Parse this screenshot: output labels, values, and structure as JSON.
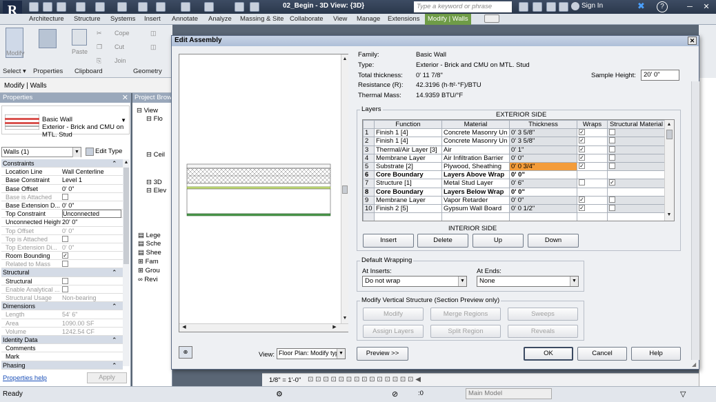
{
  "app": {
    "logo_letter": "R",
    "doc_title": "02_Begin - 3D View: {3D}",
    "search_placeholder": "Type a keyword or phrase",
    "sign_in": "Sign In",
    "help": "?",
    "close_x": "✕"
  },
  "ribbon_tabs": [
    "Architecture",
    "Structure",
    "Systems",
    "Insert",
    "Annotate",
    "Analyze",
    "Massing & Site",
    "Collaborate",
    "View",
    "Manage",
    "Extensions",
    "Modify | Walls"
  ],
  "ribbon": {
    "modify": "Modify",
    "paste": "Paste",
    "cope": "Cope",
    "cut": "Cut",
    "join": "Join",
    "groups": {
      "select": "Select",
      "properties": "Properties",
      "clipboard": "Clipboard",
      "geometry": "Geometry"
    }
  },
  "context_label": "Modify | Walls",
  "properties": {
    "header": "Properties",
    "type_family": "Basic Wall",
    "type_name": "Exterior - Brick and CMU on MTL. Stud",
    "instance_selector": "Walls (1)",
    "edit_type": "Edit Type",
    "rows": [
      {
        "k": "Constraints",
        "v": "",
        "group": true
      },
      {
        "k": "Location Line",
        "v": "Wall Centerline"
      },
      {
        "k": "Base Constraint",
        "v": "Level 1"
      },
      {
        "k": "Base Offset",
        "v": "0' 0\""
      },
      {
        "k": "Base is Attached",
        "v": "",
        "check": false,
        "dim": true
      },
      {
        "k": "Base Extension D...",
        "v": "0' 0\""
      },
      {
        "k": "Top Constraint",
        "v": "Unconnected"
      },
      {
        "k": "Unconnected Height",
        "v": "20' 0\""
      },
      {
        "k": "Top Offset",
        "v": "0' 0\"",
        "dim": true
      },
      {
        "k": "Top is Attached",
        "v": "",
        "check": false,
        "dim": true
      },
      {
        "k": "Top Extension Di...",
        "v": "0' 0\"",
        "dim": true
      },
      {
        "k": "Room Bounding",
        "v": "",
        "check": true
      },
      {
        "k": "Related to Mass",
        "v": "",
        "check": false,
        "dim": true
      },
      {
        "k": "Structural",
        "v": "",
        "group": true
      },
      {
        "k": "Structural",
        "v": "",
        "check": false
      },
      {
        "k": "Enable Analytical ...",
        "v": "",
        "check": false,
        "dim": true
      },
      {
        "k": "Structural Usage",
        "v": "Non-bearing",
        "dim": true
      },
      {
        "k": "Dimensions",
        "v": "",
        "group": true
      },
      {
        "k": "Length",
        "v": "54' 6\"",
        "dim": true
      },
      {
        "k": "Area",
        "v": "1090.00 SF",
        "dim": true
      },
      {
        "k": "Volume",
        "v": "1242.54 CF",
        "dim": true
      },
      {
        "k": "Identity Data",
        "v": "",
        "group": true
      },
      {
        "k": "Comments",
        "v": ""
      },
      {
        "k": "Mark",
        "v": ""
      },
      {
        "k": "Phasing",
        "v": "",
        "group": true
      }
    ],
    "help_link": "Properties help",
    "apply": "Apply"
  },
  "project_browser": {
    "header": "Project Brow",
    "items": [
      "View",
      "Flo",
      "Ceil",
      "3D",
      "Elev",
      "Lege",
      "Sche",
      "Shee",
      "Fam",
      "Grou",
      "Revi"
    ]
  },
  "dialog": {
    "title": "Edit Assembly",
    "info": [
      {
        "label": "Family:",
        "value": "Basic Wall"
      },
      {
        "label": "Type:",
        "value": "Exterior - Brick and CMU on MTL. Stud"
      },
      {
        "label": "Total thickness:",
        "value": "0'  11 7/8\""
      },
      {
        "label": "Resistance (R):",
        "value": "42.3196 (h·ft²·°F)/BTU"
      },
      {
        "label": "Thermal Mass:",
        "value": "14.9359 BTU/°F"
      }
    ],
    "sample_height_label": "Sample Height:",
    "sample_height_value": "20'  0\"",
    "layers_title": "Layers",
    "exterior_side": "EXTERIOR SIDE",
    "interior_side": "INTERIOR SIDE",
    "columns": [
      "",
      "Function",
      "Material",
      "Thickness",
      "Wraps",
      "Structural Material"
    ],
    "layers": [
      {
        "n": "1",
        "function": "Finish 1 [4]",
        "material": "Concrete Masonry Un",
        "thickness": "0'  3 5/8\"",
        "wraps": true,
        "struct": false
      },
      {
        "n": "2",
        "function": "Finish 1 [4]",
        "material": "Concrete Masonry Un",
        "thickness": "0'  3 5/8\"",
        "wraps": true,
        "struct": false
      },
      {
        "n": "3",
        "function": "Thermal/Air Layer [3]",
        "material": "Air",
        "thickness": "0'  1\"",
        "wraps": true,
        "struct": false
      },
      {
        "n": "4",
        "function": "Membrane Layer",
        "material": "Air Infiltration Barrier",
        "thickness": "0'  0\"",
        "wraps": true,
        "struct": false
      },
      {
        "n": "5",
        "function": "Substrate [2]",
        "material": "Plywood, Sheathing",
        "thickness": "0'  0 3/4\"",
        "wraps": true,
        "struct": false,
        "highlight": true
      },
      {
        "n": "6",
        "function": "Core Boundary",
        "material": "Layers Above Wrap",
        "thickness": "0'  0\"",
        "core": true
      },
      {
        "n": "7",
        "function": "Structure [1]",
        "material": "Metal Stud Layer",
        "thickness": "0'  6\"",
        "wraps": false,
        "struct": true
      },
      {
        "n": "8",
        "function": "Core Boundary",
        "material": "Layers Below Wrap",
        "thickness": "0'  0\"",
        "core": true
      },
      {
        "n": "9",
        "function": "Membrane Layer",
        "material": "Vapor Retarder",
        "thickness": "0'  0\"",
        "wraps": true,
        "struct": false
      },
      {
        "n": "10",
        "function": "Finish 2 [5]",
        "material": "Gypsum Wall Board",
        "thickness": "0'  0 1/2\"",
        "wraps": true,
        "struct": false
      }
    ],
    "layer_buttons": {
      "insert": "Insert",
      "delete": "Delete",
      "up": "Up",
      "down": "Down"
    },
    "wrapping": {
      "title": "Default Wrapping",
      "at_inserts_label": "At Inserts:",
      "at_inserts_value": "Do not wrap",
      "at_ends_label": "At Ends:",
      "at_ends_value": "None"
    },
    "vertical": {
      "title": "Modify Vertical Structure (Section Preview only)",
      "buttons": [
        "Modify",
        "Merge Regions",
        "Sweeps",
        "Assign Layers",
        "Split Region",
        "Reveals"
      ]
    },
    "view_label": "View:",
    "view_value": "Floor Plan: Modify typ",
    "preview_btn": "Preview >>",
    "ok": "OK",
    "cancel": "Cancel",
    "help": "Help"
  },
  "view_control": {
    "scale": "1/8\" = 1'-0\""
  },
  "status": {
    "text": "Ready",
    "z_value": ":0",
    "model": "Main Model"
  },
  "colors": {
    "accent_tab": "#6f9c47",
    "highlight_cell": "#f39c3a",
    "titlebar": "#2a374b"
  }
}
